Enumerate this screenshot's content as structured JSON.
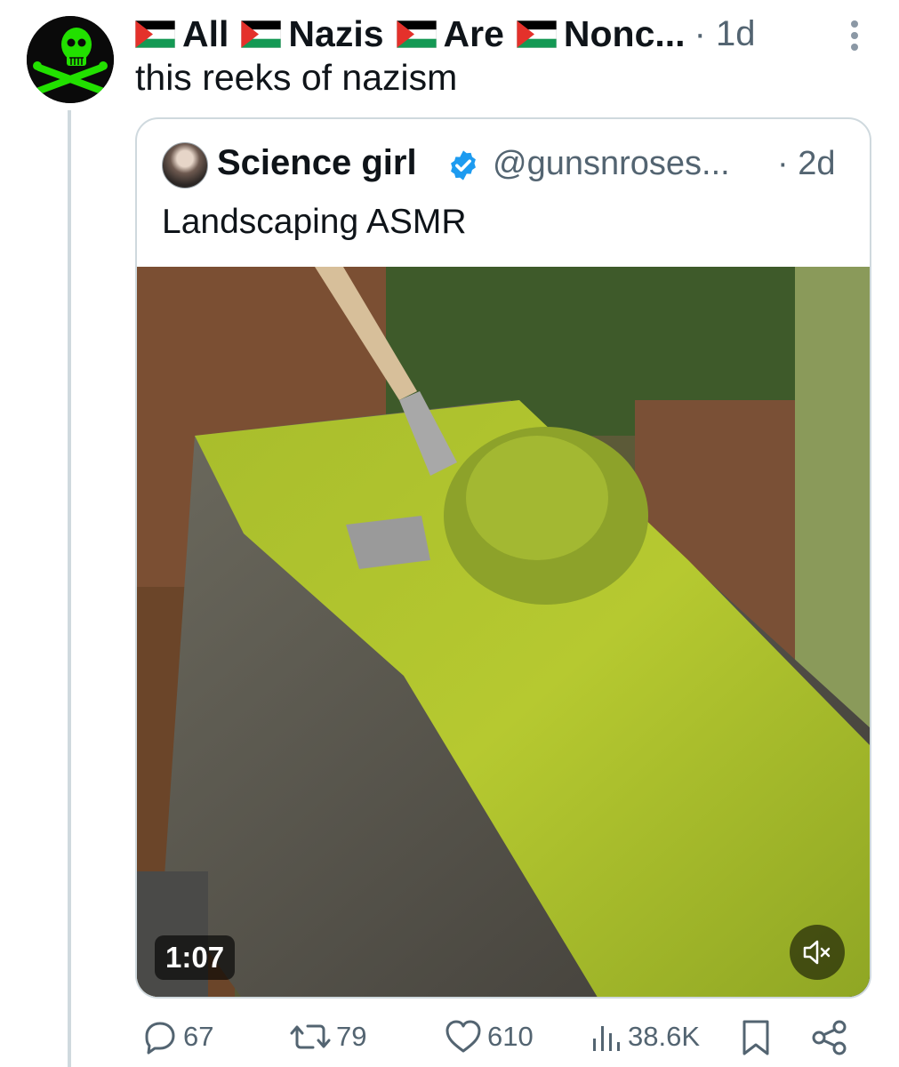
{
  "tweet": {
    "author": {
      "name_words": [
        "All",
        "Nazis",
        "Are",
        "Nonc..."
      ],
      "avatar_icon": "green-skull-avatar-icon"
    },
    "time": "· 1d",
    "text": "this reeks of nazism",
    "more_icon": "more-vertical-icon"
  },
  "quote": {
    "author_name": "Science girl",
    "verified_icon": "verified-badge-icon",
    "handle": "@gunsnroses...",
    "time": "· 2d",
    "text": "Landscaping ASMR",
    "video": {
      "duration": "1:07",
      "mute_icon": "speaker-muted-icon"
    }
  },
  "actions": {
    "replies": "67",
    "reposts": "79",
    "likes": "610",
    "views": "38.6K",
    "bookmark_icon": "bookmark-icon",
    "share_icon": "share-icon"
  },
  "colors": {
    "secondary_text": "#536471",
    "verified_blue": "#1d9bf0",
    "avatar_green": "#22e000",
    "flag_red": "#e4312b",
    "flag_green": "#149954"
  }
}
